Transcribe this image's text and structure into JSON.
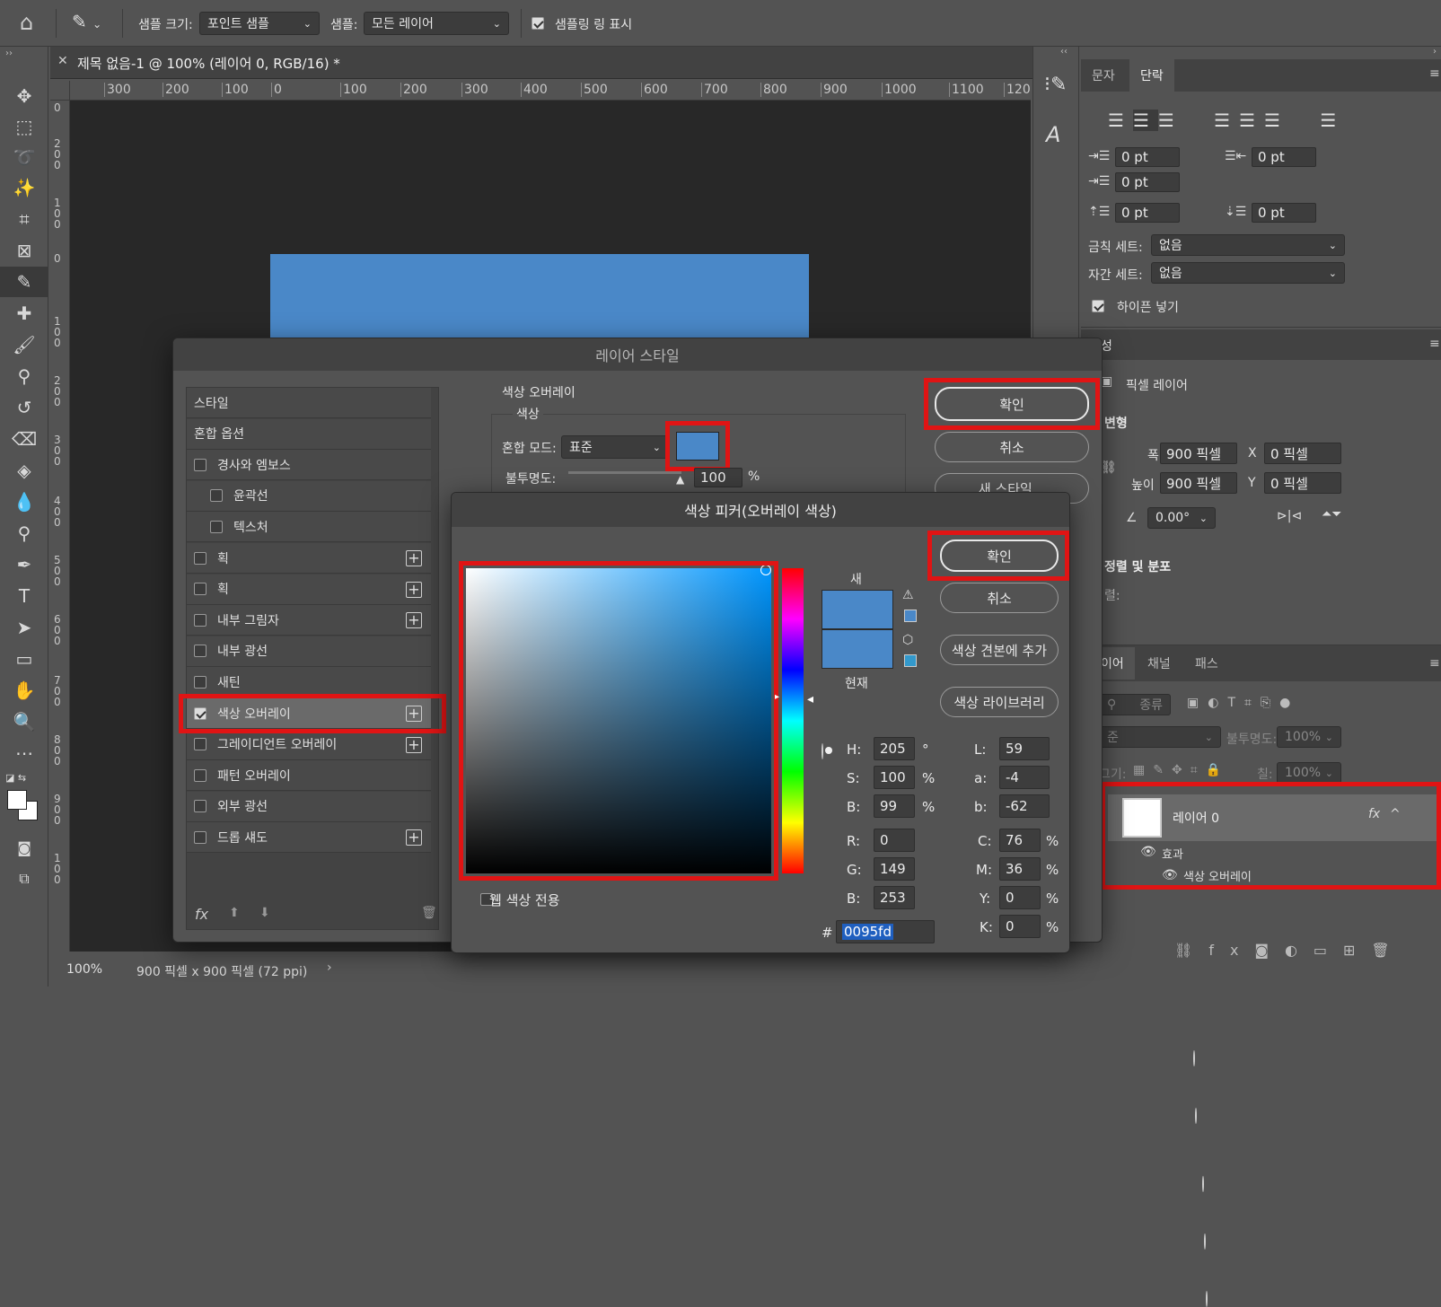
{
  "options_bar": {
    "sample_size_label": "샘플 크기:",
    "sample_size_value": "포인트 샘플",
    "sample_label": "샘플:",
    "sample_value": "모든 레이어",
    "show_sampling_ring_label": "샘플링 링 표시"
  },
  "document": {
    "tab_title": "제목 없음-1 @ 100% (레이어 0, RGB/16) *",
    "ruler_h": [
      "300",
      "200",
      "100",
      "0",
      "100",
      "200",
      "300",
      "400",
      "500",
      "600",
      "700",
      "800",
      "900",
      "1000",
      "1100",
      "120"
    ],
    "ruler_v": [
      "0",
      "200",
      "100",
      "0",
      "100",
      "200",
      "300",
      "400",
      "500",
      "600",
      "700",
      "800",
      "900",
      "100"
    ],
    "zoom": "100%",
    "doc_info": "900 픽셀 x 900 픽셀 (72 ppi)",
    "shape_color": "#4a88c8"
  },
  "paragraph_panel": {
    "tabs": [
      "문자",
      "단락"
    ],
    "indent_left": "0 pt",
    "indent_right": "0 pt",
    "first_line": "0 pt",
    "space_before": "0 pt",
    "space_after": "0 pt",
    "kinsoku_label": "금칙 세트:",
    "kinsoku_value": "없음",
    "mojikumi_label": "자간 세트:",
    "mojikumi_value": "없음",
    "hyphen_label": "하이픈 넣기"
  },
  "properties_panel": {
    "title_partial": "성",
    "pixel_layer": "픽셀 레이어",
    "transform_label": "변형",
    "width_label": "폭",
    "width_value": "900 픽셀",
    "height_label": "높이",
    "height_value": "900 픽셀",
    "x_label": "X",
    "x_value": "0 픽셀",
    "y_label": "Y",
    "y_value": "0 픽셀",
    "angle_value": "0.00°",
    "align_label": "정렬 및 분포",
    "align_partial": "렬:"
  },
  "layers_panel": {
    "tabs": [
      "이어",
      "채널",
      "패스"
    ],
    "filter_label": "종류",
    "blend_partial": "준",
    "opacity_label": "불투명도:",
    "opacity_value": "100%",
    "lock_partial": "그기:",
    "fill_label": "칠:",
    "fill_value": "100%",
    "layer_name": "레이어 0",
    "effects_label": "효과",
    "effect_item": "색상 오버레이"
  },
  "layer_style_dialog": {
    "title": "레이어 스타일",
    "styles": [
      "스타일",
      "혼합 옵션",
      "경사와 엠보스",
      "윤곽선",
      "텍스처",
      "획",
      "획",
      "내부 그림자",
      "내부 광선",
      "새틴",
      "색상 오버레이",
      "그레이디언트 오버레이",
      "패턴 오버레이",
      "외부 광선",
      "드롭 섀도"
    ],
    "section_title": "색상 오버레이",
    "sub_title": "색상",
    "blend_mode_label": "혼합 모드:",
    "blend_mode_value": "표준",
    "opacity_label": "불투명도:",
    "opacity_value": "100",
    "opacity_unit": "%",
    "ok": "확인",
    "cancel": "취소",
    "new_style": "새 스타일..."
  },
  "color_picker": {
    "title": "색상 피커(오버레이 색상)",
    "ok": "확인",
    "cancel": "취소",
    "add_swatch": "색상 견본에 추가",
    "library": "색상 라이브러리",
    "new_label": "새",
    "current_label": "현재",
    "new_color": "#4a88c8",
    "current_color": "#4a88c8",
    "web_only": "웹 색상 전용",
    "H": "205",
    "H_unit": "°",
    "S": "100",
    "S_unit": "%",
    "Bv": "99",
    "Bv_unit": "%",
    "R": "0",
    "G": "149",
    "B": "253",
    "L": "59",
    "a": "-4",
    "b": "-62",
    "C": "76",
    "M": "36",
    "Y": "0",
    "K": "0",
    "pct": "%",
    "hex": "0095fd",
    "hex_label": "#"
  }
}
